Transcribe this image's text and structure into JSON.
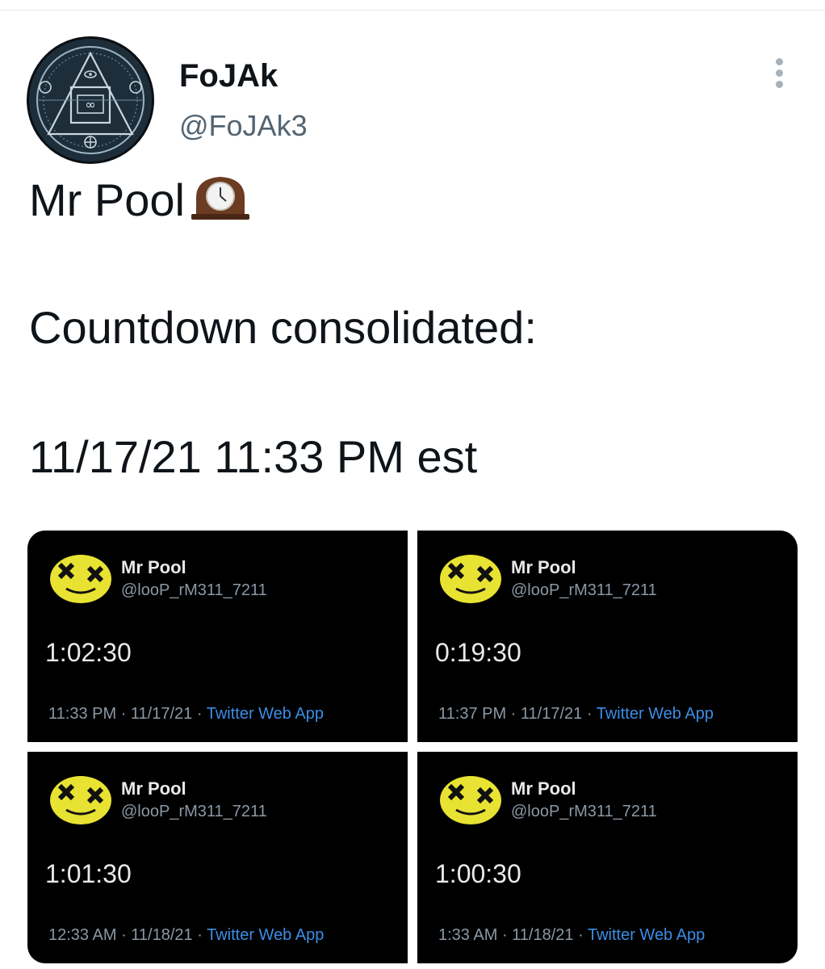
{
  "author": {
    "name": "FoJAk",
    "handle": "@FoJAk3"
  },
  "tweet": {
    "line1": "Mr Pool",
    "line2": "Countdown consolidated:",
    "line3": "11/17/21  11:33 PM est",
    "emoji": "mantelpiece-clock-icon"
  },
  "images": [
    {
      "name": "Mr Pool",
      "handle": "@looP_rM311_7211",
      "count": "1:02:30",
      "time": "11:33 PM",
      "date": "11/17/21",
      "source": "Twitter Web App"
    },
    {
      "name": "Mr Pool",
      "handle": "@looP_rM311_7211",
      "count": "0:19:30",
      "time": "11:37 PM",
      "date": "11/17/21",
      "source": "Twitter Web App"
    },
    {
      "name": "Mr Pool",
      "handle": "@looP_rM311_7211",
      "count": "1:01:30",
      "time": "12:33 AM",
      "date": "11/18/21",
      "source": "Twitter Web App"
    },
    {
      "name": "Mr Pool",
      "handle": "@looP_rM311_7211",
      "count": "1:00:30",
      "time": "1:33 AM",
      "date": "11/18/21",
      "source": "Twitter Web App"
    }
  ],
  "separator": " · ",
  "colors": {
    "text": "#0f1419",
    "muted": "#536471",
    "link": "#3b8ee6",
    "tile_bg": "#000000",
    "smiley": "#e8e232"
  }
}
